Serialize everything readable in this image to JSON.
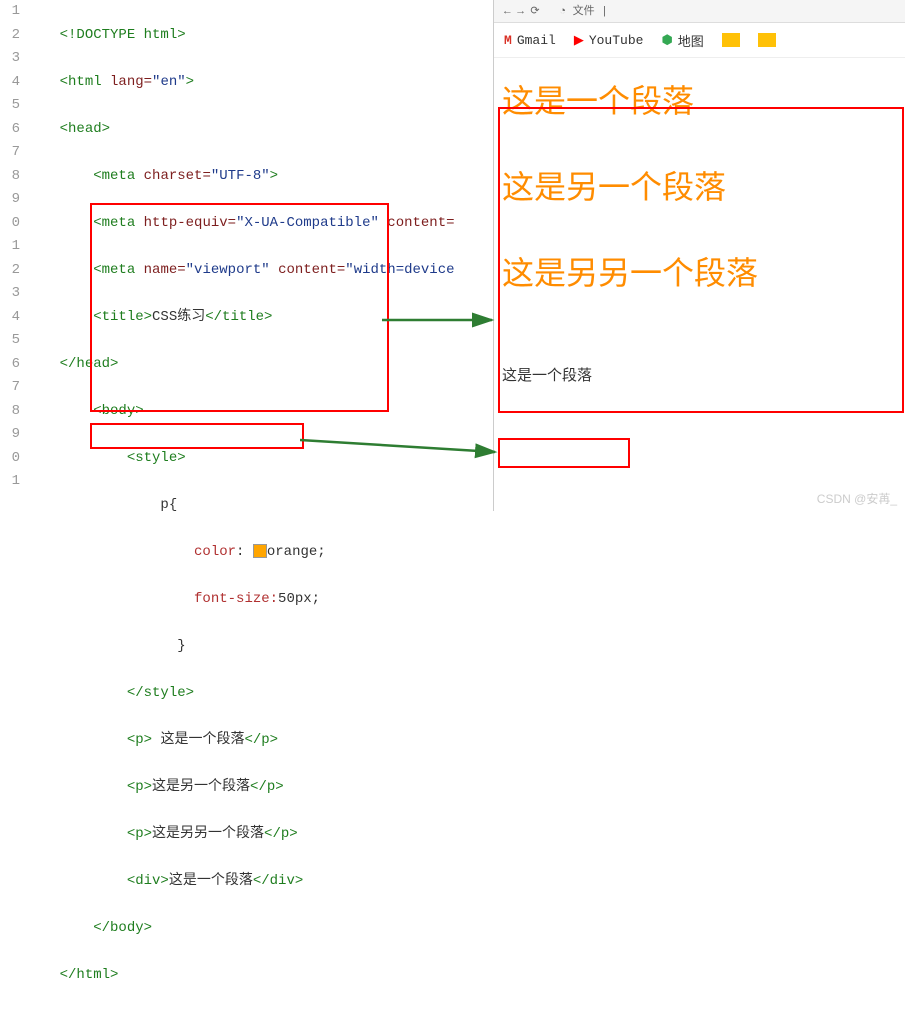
{
  "line_numbers": [
    "1",
    "2",
    "3",
    "4",
    "5",
    "6",
    "7",
    "8",
    "9",
    "0",
    "1",
    "2",
    "3",
    "4",
    "5",
    "6",
    "7",
    "8",
    "9",
    "0",
    "1"
  ],
  "code": {
    "l1": {
      "t": "<!DOCTYPE html>"
    },
    "l2": {
      "o": "<html",
      "a": " lang=",
      "v": "\"en\"",
      "c": ">"
    },
    "l3": {
      "t": "<head>"
    },
    "l4": {
      "o": "<meta",
      "a": " charset=",
      "v": "\"UTF-8\"",
      "c": ">"
    },
    "l5": {
      "o": "<meta",
      "a": " http-equiv=",
      "v": "\"X-UA-Compatible\"",
      "a2": " content=",
      "c": ""
    },
    "l6": {
      "o": "<meta",
      "a": " name=",
      "v": "\"viewport\"",
      "a2": " content=",
      "v2": "\"width=device",
      "c": ""
    },
    "l7": {
      "o": "<title>",
      "t": "CSS练习",
      "c": "</title>"
    },
    "l8": {
      "t": "</head>"
    },
    "l9": {
      "t": "<body>"
    },
    "l10": {
      "t": "<style>"
    },
    "l11": {
      "t": "p{"
    },
    "l12": {
      "p": "color",
      "v": "orange;"
    },
    "l13": {
      "p": "font-size:",
      "v": "50px;"
    },
    "l14": {
      "t": "}"
    },
    "l15": {
      "t": "</style>"
    },
    "l16": {
      "o": "<p>",
      "t": " 这是一个段落",
      "c": "</p>"
    },
    "l17": {
      "o": "<p>",
      "t": "这是另一个段落",
      "c": "</p>"
    },
    "l18": {
      "o": "<p>",
      "t": "这是另另一个段落",
      "c": "</p>"
    },
    "l19": {
      "o": "<div>",
      "t": "这是一个段落",
      "c": "</div>"
    },
    "l20": {
      "t": "</body>"
    },
    "l21": {
      "t": "</html>"
    }
  },
  "browser": {
    "addr_hint": "文件",
    "bookmarks": {
      "gmail": "Gmail",
      "youtube": "YouTube",
      "map": "地图"
    },
    "para1": "这是一个段落",
    "para2": "这是另一个段落",
    "para3": "这是另另一个段落",
    "para4": "这是一个段落"
  },
  "watermark": "CSDN @安苒_"
}
